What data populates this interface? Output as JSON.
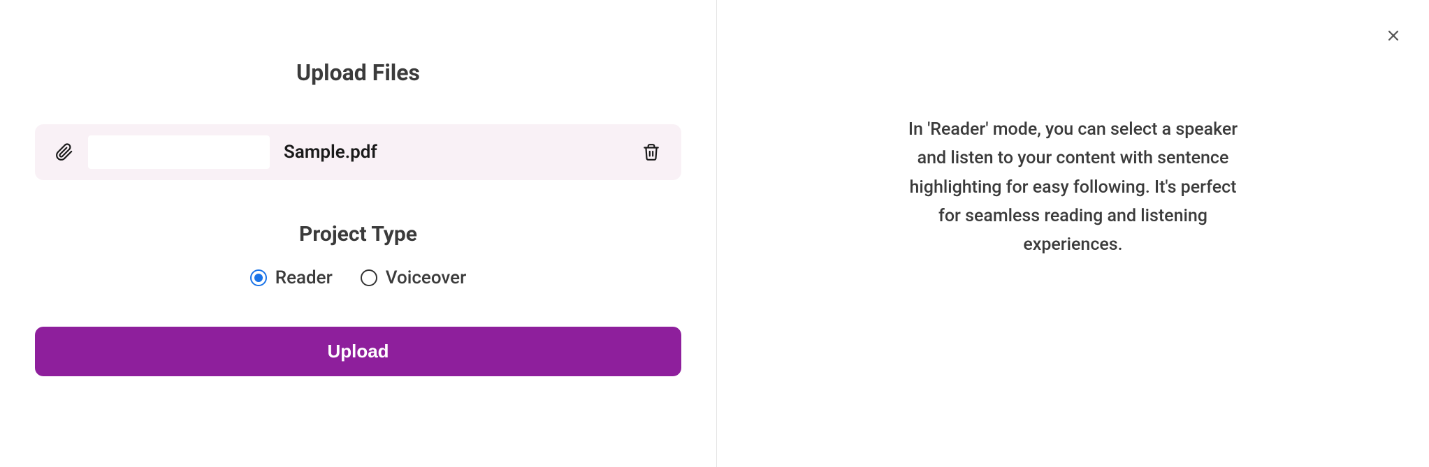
{
  "main": {
    "title": "Upload Files",
    "file": {
      "name": "Sample.pdf"
    },
    "project_type": {
      "label": "Project Type",
      "options": {
        "reader": "Reader",
        "voiceover": "Voiceover"
      },
      "selected": "reader"
    },
    "upload_label": "Upload"
  },
  "side": {
    "info": "In 'Reader' mode, you can select a speaker and listen to your content with sentence highlighting for easy following. It's perfect for seamless reading and listening experiences."
  }
}
